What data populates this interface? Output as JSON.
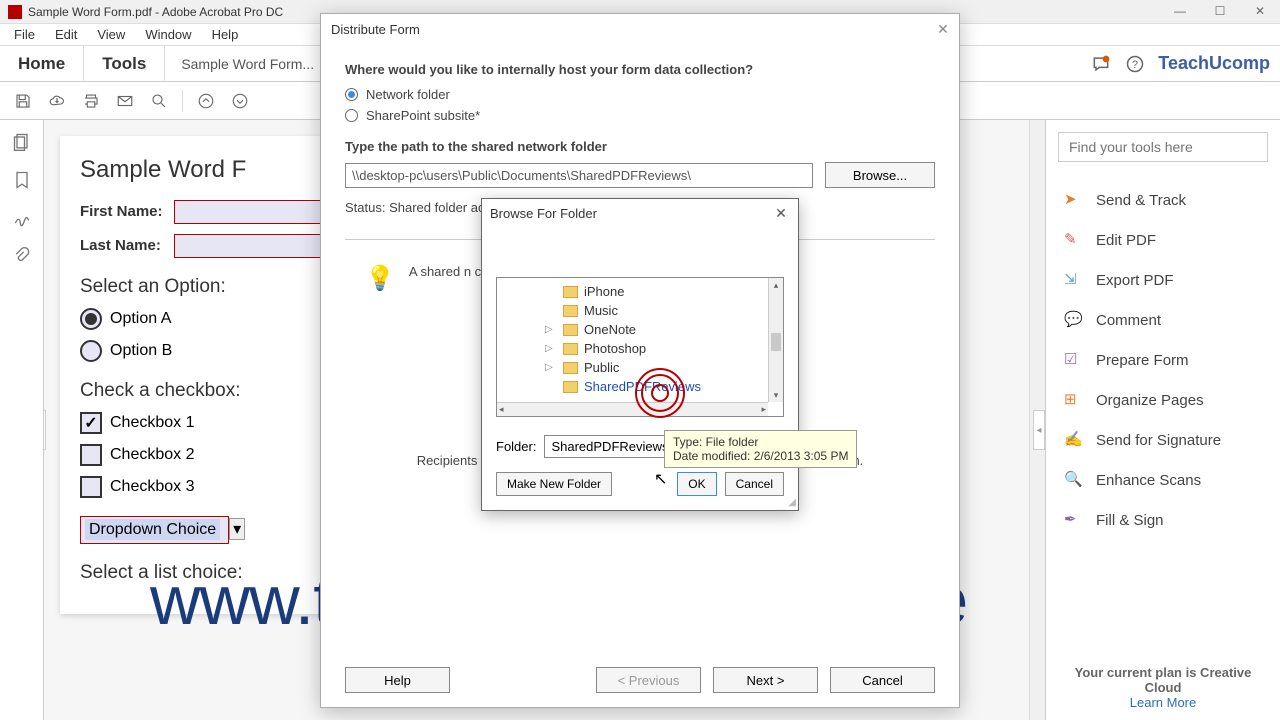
{
  "window": {
    "title": "Sample Word Form.pdf - Adobe Acrobat Pro DC"
  },
  "menu": {
    "file": "File",
    "edit": "Edit",
    "view": "View",
    "window": "Window",
    "help": "Help"
  },
  "tabs": {
    "home": "Home",
    "tools": "Tools",
    "doc": "Sample Word Form..."
  },
  "brand": "TeachUcomp",
  "rightpanel": {
    "search_placeholder": "Find your tools here",
    "items": [
      "Send & Track",
      "Edit PDF",
      "Export PDF",
      "Comment",
      "Prepare Form",
      "Organize Pages",
      "Send for Signature",
      "Enhance Scans",
      "Fill & Sign"
    ],
    "footer1": "Your current plan is Creative",
    "footer2": "Cloud",
    "learn": "Learn More"
  },
  "doc": {
    "title": "Sample Word F",
    "first": "First Name:",
    "last": "Last Name:",
    "select_option": "Select an Option:",
    "optA": "Option A",
    "optB": "Option B",
    "check_heading": "Check a checkbox:",
    "cb1": "Checkbox 1",
    "cb2": "Checkbox 2",
    "cb3": "Checkbox 3",
    "dropdown_val": "Dropdown Choice",
    "list_heading": "Select a list choice:"
  },
  "distribute": {
    "title": "Distribute Form",
    "question": "Where would you like to internally host your form data collection?",
    "opt_network": "Network folder",
    "opt_sharepoint": "SharePoint subsite*",
    "path_label": "Type the path to the shared network folder",
    "path_value": "\\\\desktop-pc\\users\\Public\\Documents\\SharedPDFReviews\\",
    "browse": "Browse...",
    "status": "Status: Shared folder acce                                                              y the location",
    "info": "A shared n                                                                  cess to the shared f",
    "fill_note": "Recipients can use Adobe Acrobat or Adobe Acrobat Reader to fill in the form.",
    "help": "Help",
    "prev": "< Previous",
    "next": "Next >",
    "cancel": "Cancel"
  },
  "bff": {
    "title": "Browse For Folder",
    "items": [
      "iPhone",
      "Music",
      "OneNote",
      "Photoshop",
      "Public",
      "SharedPDFReviews"
    ],
    "folder_label": "Folder:",
    "folder_value": "SharedPDFReviews",
    "make_new": "Make New Folder",
    "ok": "OK",
    "cancel": "Cancel"
  },
  "tooltip": {
    "line1": "Type: File folder",
    "line2": "Date modified: 2/6/2013 3:05 PM"
  },
  "watermark": "www.teachucomp.com/free",
  "rp_colors": [
    "#e08030",
    "#d85a5a",
    "#5aa0d8",
    "#e0b030",
    "#9a6ad0",
    "#f28030",
    "#5aa0d8",
    "#4aa080",
    "#8a60c0"
  ]
}
